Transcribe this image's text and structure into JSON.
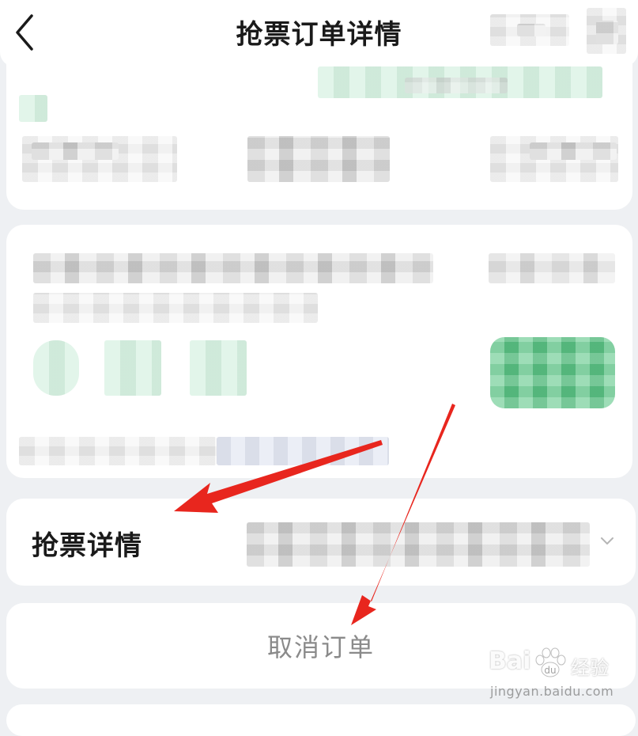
{
  "header": {
    "title": "抢票订单详情",
    "back_icon": "chevron-left-icon"
  },
  "detail_row": {
    "label": "抢票详情",
    "chevron_icon": "chevron-down-icon"
  },
  "actions": {
    "cancel_label": "取消订单"
  },
  "watermark": {
    "brand_left": "Bai",
    "brand_right": "经验",
    "url": "jingyan.baidu.com"
  },
  "colors": {
    "accent_green": "#5cc787",
    "arrow_red": "#e8261e",
    "muted_text": "#8a8a8a"
  }
}
